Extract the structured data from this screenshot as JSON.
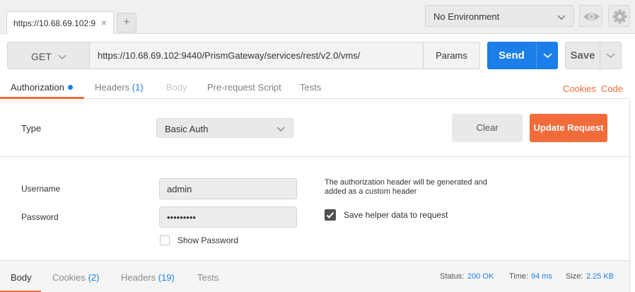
{
  "tabs": {
    "request_tab_label": "https://10.68.69.102:9",
    "close_glyph": "×",
    "new_tab_glyph": "+"
  },
  "environment": {
    "selected": "No Environment"
  },
  "request": {
    "method": "GET",
    "url": "https://10.68.69.102:9440/PrismGateway/services/rest/v2.0/vms/",
    "params_label": "Params",
    "send_label": "Send",
    "save_label": "Save"
  },
  "request_tabs": {
    "authorization": "Authorization",
    "headers": "Headers",
    "headers_count": "(1)",
    "body": "Body",
    "pre_request": "Pre-request Script",
    "tests": "Tests",
    "cookies_link": "Cookies",
    "code_link": "Code"
  },
  "auth": {
    "type_label": "Type",
    "type_value": "Basic Auth",
    "clear_label": "Clear",
    "update_label": "Update Request",
    "username_label": "Username",
    "username_value": "admin",
    "password_label": "Password",
    "password_value": "•••••••••",
    "show_password_label": "Show Password",
    "show_password_checked": false,
    "helper_text": "The authorization header will be generated and added as a custom header",
    "save_helper_label": "Save helper data to request",
    "save_helper_checked": true
  },
  "response": {
    "tabs": {
      "body": "Body",
      "cookies": "Cookies",
      "cookies_count": "(2)",
      "headers": "Headers",
      "headers_count": "(19)",
      "tests": "Tests"
    },
    "status_label": "Status:",
    "status_value": "200 OK",
    "time_label": "Time:",
    "time_value": "94 ms",
    "size_label": "Size:",
    "size_value": "2.25 KB"
  },
  "colors": {
    "accent_blue": "#1c7ee8",
    "accent_orange": "#f26b3a"
  },
  "icons": [
    "close-icon",
    "plus-icon",
    "chevron-down-icon",
    "eye-icon",
    "gear-icon",
    "checkmark-icon"
  ]
}
